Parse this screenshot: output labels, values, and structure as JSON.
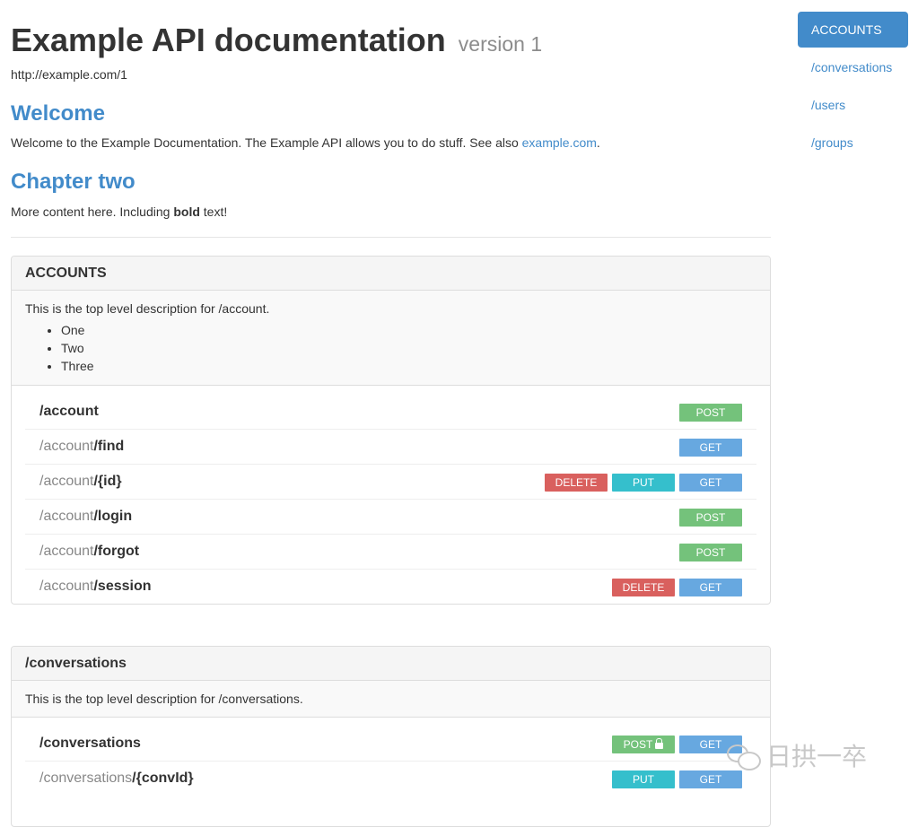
{
  "header": {
    "title": "Example API documentation",
    "version": "version 1",
    "base_url": "http://example.com/1"
  },
  "welcome": {
    "heading": "Welcome",
    "text": "Welcome to the Example Documentation. The Example API allows you to do stuff. See also ",
    "link": "example.com",
    "period": "."
  },
  "chapter_two": {
    "heading": "Chapter two",
    "text_before": "More content here. Including ",
    "bold": "bold",
    "text_after": " text!"
  },
  "sidebar": {
    "items": [
      "ACCOUNTS",
      "/conversations",
      "/users",
      "/groups"
    ],
    "active_index": 0
  },
  "panels": [
    {
      "heading": "ACCOUNTS",
      "description": "This is the top level description for /account.",
      "list": [
        "One",
        "Two",
        "Three"
      ],
      "rows": [
        {
          "prefix": "",
          "path": "/account",
          "methods": [
            "POST"
          ]
        },
        {
          "prefix": "/account",
          "path": "/find",
          "methods": [
            "GET"
          ]
        },
        {
          "prefix": "/account",
          "path": "/{id}",
          "methods": [
            "DELETE",
            "PUT",
            "GET"
          ]
        },
        {
          "prefix": "/account",
          "path": "/login",
          "methods": [
            "POST"
          ]
        },
        {
          "prefix": "/account",
          "path": "/forgot",
          "methods": [
            "POST"
          ]
        },
        {
          "prefix": "/account",
          "path": "/session",
          "methods": [
            "DELETE",
            "GET"
          ]
        }
      ]
    },
    {
      "heading": "/conversations",
      "description": "This is the top level description for /conversations.",
      "list": [],
      "rows": [
        {
          "prefix": "",
          "path": "/conversations",
          "methods": [
            "POST",
            "GET"
          ],
          "locked": [
            "POST"
          ]
        },
        {
          "prefix": "/conversations",
          "path": "/{convId}",
          "methods": [
            "PUT",
            "GET"
          ]
        }
      ]
    }
  ],
  "watermark": {
    "text": "日拱一卒",
    "icon": "wechat-icon"
  },
  "colors": {
    "accent": "#428bca",
    "POST": "#74c27b",
    "GET": "#67a8e0",
    "PUT": "#35bfcc",
    "DELETE": "#d9605e"
  }
}
